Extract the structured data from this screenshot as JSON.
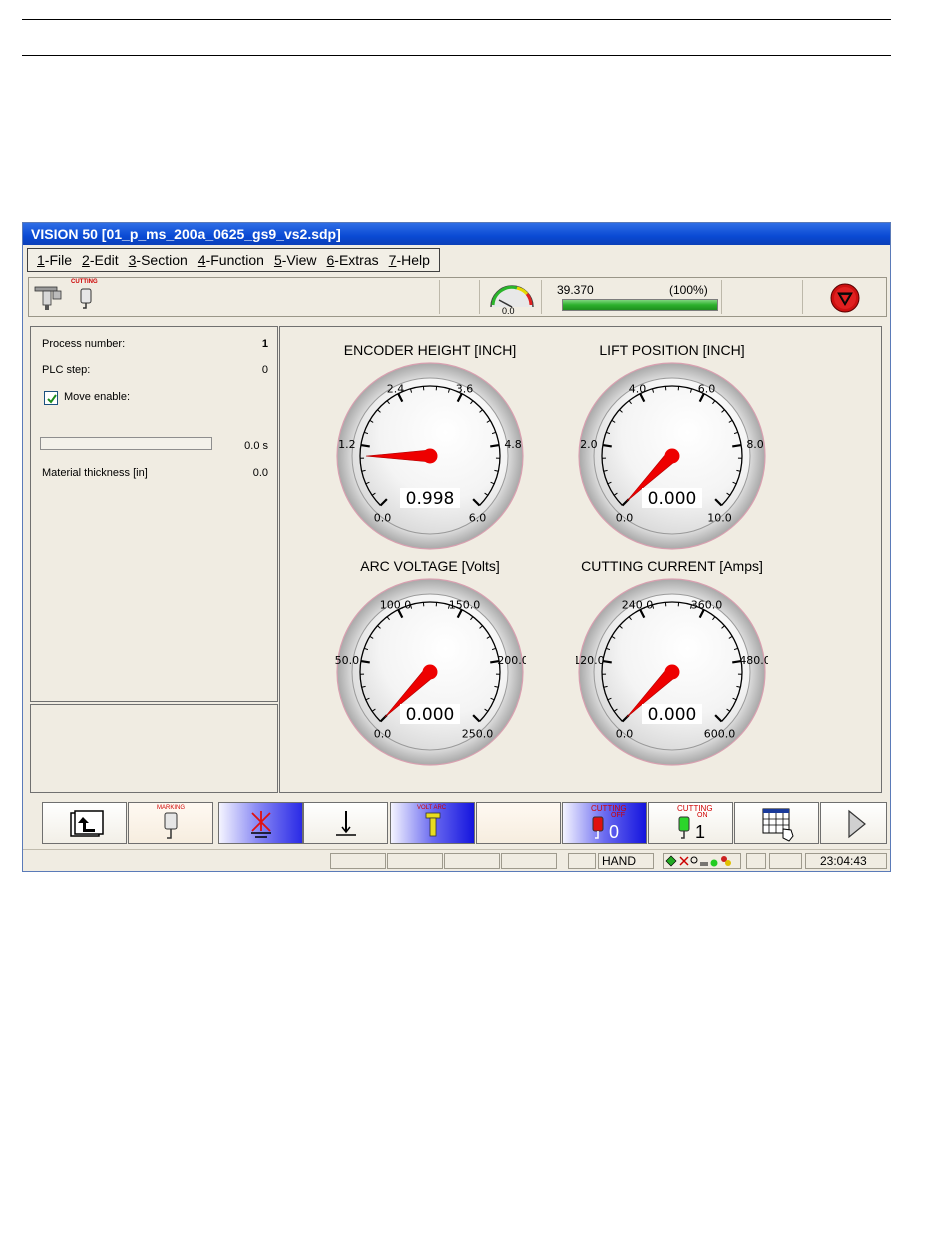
{
  "window": {
    "title": "VISION 50 [01_p_ms_200a_0625_gs9_vs2.sdp]"
  },
  "menu": [
    {
      "key": "1",
      "label": "-File"
    },
    {
      "key": "2",
      "label": "-Edit"
    },
    {
      "key": "3",
      "label": "-Section"
    },
    {
      "key": "4",
      "label": "-Function"
    },
    {
      "key": "5",
      "label": "-View"
    },
    {
      "key": "6",
      "label": "-Extras"
    },
    {
      "key": "7",
      "label": "-Help"
    }
  ],
  "toolbar": {
    "cutting_label": "CUTTING",
    "speed_gauge_value": "0.0",
    "progress_value": "39.370",
    "progress_percent": "(100%)",
    "progress_fraction": 1.0
  },
  "left_panel": {
    "process_number_label": "Process number:",
    "process_number_value": "1",
    "plc_step_label": "PLC step:",
    "plc_step_value": "0",
    "move_enable_label": "Move enable:",
    "move_enable_checked": true,
    "timer_value": "0.0 s",
    "material_thickness_label": "Material thickness [in]",
    "material_thickness_value": "0.0"
  },
  "gauges": [
    {
      "title": "ENCODER HEIGHT [INCH]",
      "value": "0.998",
      "min": 0,
      "max": 6,
      "labels": [
        "0.0",
        "1.2",
        "2.4",
        "3.6",
        "4.8",
        "6.0"
      ],
      "reading": 0.998
    },
    {
      "title": "LIFT POSITION [INCH]",
      "value": "0.000",
      "min": 0,
      "max": 10,
      "labels": [
        "0.0",
        "2.0",
        "4.0",
        "6.0",
        "8.0",
        "10.0"
      ],
      "reading": 0
    },
    {
      "title": "ARC VOLTAGE [Volts]",
      "value": "0.000",
      "min": 0,
      "max": 250,
      "labels": [
        "0.0",
        "50.0",
        "100.0",
        "150.0",
        "200.0",
        "250.0"
      ],
      "reading": 0
    },
    {
      "title": "CUTTING CURRENT [Amps]",
      "value": "0.000",
      "min": 0,
      "max": 600,
      "labels": [
        "0.0",
        "120.0",
        "240.0",
        "360.0",
        "480.0",
        "600.0"
      ],
      "reading": 0
    }
  ],
  "buttons": {
    "marking_label": "MARKING",
    "volt_arc_label": "VOLT ARC",
    "cutting_off_label": "CUTTING",
    "cutting_off_sub": "OFF",
    "cutting_off_count": "0",
    "cutting_on_label": "CUTTING",
    "cutting_on_sub": "ON",
    "cutting_on_count": "1"
  },
  "statusbar": {
    "mode": "HAND",
    "time": "23:04:43"
  },
  "colors": {
    "needle": "#ee0000",
    "progress_green": "#2cb02c",
    "title_blue": "#0a4ad4"
  }
}
